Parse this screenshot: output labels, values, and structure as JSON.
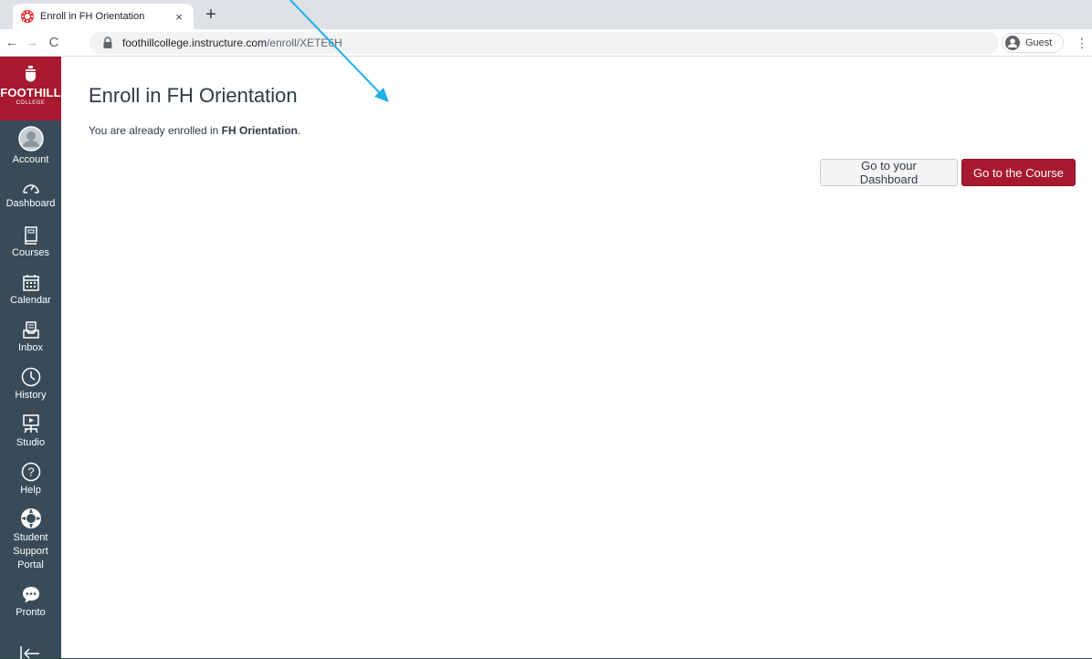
{
  "browser": {
    "tab_title": "Enroll in FH Orientation",
    "tab_close": "×",
    "new_tab": "+",
    "url_host": "foothillcollege.instructure.com",
    "url_path": "/enroll/XETE6H",
    "profile_label": "Guest",
    "back": "←",
    "forward": "→",
    "reload": "C",
    "menu": "⋮"
  },
  "sidebar": {
    "logo_name": "FOOTHILL",
    "logo_sub": "COLLEGE",
    "items": [
      {
        "label": "Account",
        "icon": "avatar-icon"
      },
      {
        "label": "Dashboard",
        "icon": "speedometer-icon"
      },
      {
        "label": "Courses",
        "icon": "book-icon"
      },
      {
        "label": "Calendar",
        "icon": "calendar-icon"
      },
      {
        "label": "Inbox",
        "icon": "inbox-icon"
      },
      {
        "label": "History",
        "icon": "clock-icon"
      },
      {
        "label": "Studio",
        "icon": "studio-icon"
      },
      {
        "label": "Help",
        "icon": "help-icon"
      },
      {
        "label": "Student\nSupport\nPortal",
        "icon": "lifebuoy-icon"
      },
      {
        "label": "Pronto",
        "icon": "chat-bubble-icon"
      }
    ],
    "colors": {
      "nav_bg": "#394b58",
      "brand": "#a6192e"
    }
  },
  "main": {
    "title": "Enroll in FH Orientation",
    "message_prefix": "You are already enrolled in ",
    "message_course": "FH Orientation",
    "message_suffix": ".",
    "dashboard_button": "Go to your Dashboard",
    "course_button": "Go to the Course"
  },
  "annotation": {
    "type": "arrow",
    "color": "#1fb0e6"
  }
}
